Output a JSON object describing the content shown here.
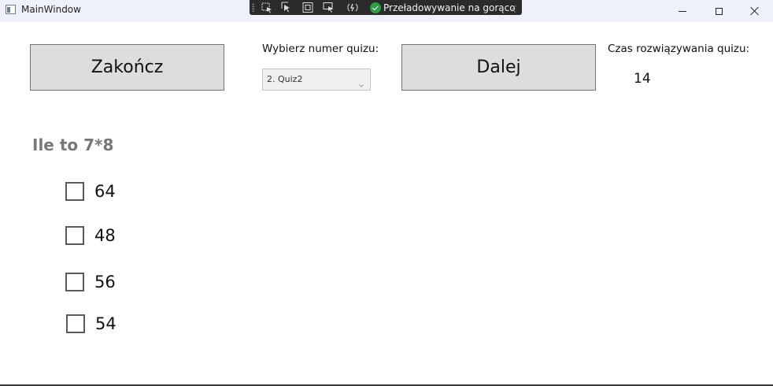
{
  "window": {
    "title": "MainWindow",
    "minimize_icon": "minimize-icon",
    "maximize_icon": "maximize-icon",
    "close_icon": "close-icon"
  },
  "debug_toolbar": {
    "icons": [
      "select-element-icon",
      "pointer-icon",
      "display-layout-icon",
      "track-focus-icon",
      "hot-reload-icon"
    ],
    "hot_reload_status": "Przeładowywanie na gorąco",
    "status_color": "#2e9e44"
  },
  "header": {
    "finish_button": "Zakończ",
    "quiz_select_label": "Wybierz numer quizu:",
    "quiz_select_value": "2. Quiz2",
    "next_button": "Dalej",
    "time_label": "Czas rozwiązywania quizu:",
    "time_value": "14"
  },
  "question": {
    "text": "Ile to 7*8",
    "options": [
      {
        "label": "64",
        "checked": false
      },
      {
        "label": "48",
        "checked": false
      },
      {
        "label": "56",
        "checked": false
      },
      {
        "label": "54",
        "checked": false
      }
    ]
  }
}
